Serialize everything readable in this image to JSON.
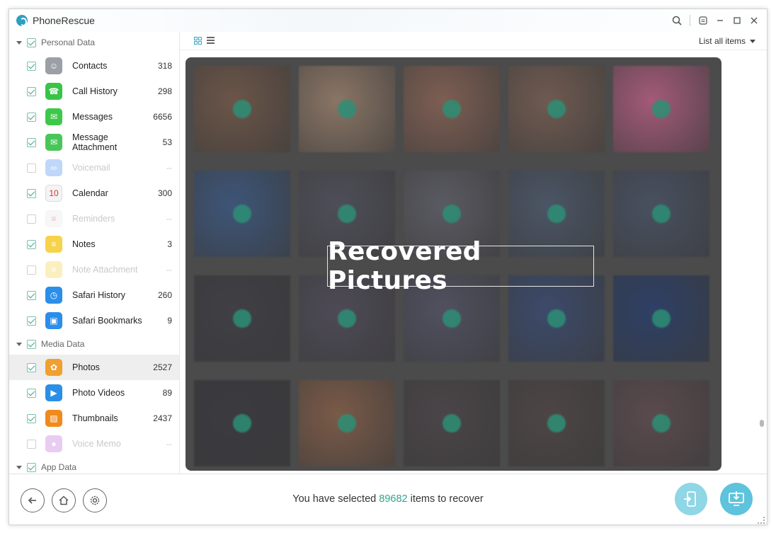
{
  "app": {
    "title": "PhoneRescue"
  },
  "titlebar": {
    "icons": [
      "search-icon",
      "menu-icon",
      "minimize-icon",
      "maximize-icon",
      "close-icon"
    ]
  },
  "sidebar": {
    "sections": [
      {
        "label": "Personal Data",
        "checked": true,
        "items": [
          {
            "label": "Contacts",
            "count": "318",
            "enabled": true,
            "checked": true,
            "icon": "contacts-icon",
            "color": "#9aa0a6"
          },
          {
            "label": "Call History",
            "count": "298",
            "enabled": true,
            "checked": true,
            "icon": "phone-icon",
            "color": "#39c447"
          },
          {
            "label": "Messages",
            "count": "6656",
            "enabled": true,
            "checked": true,
            "icon": "messages-icon",
            "color": "#3ec84a"
          },
          {
            "label": "Message Attachment",
            "count": "53",
            "enabled": true,
            "checked": true,
            "icon": "attachment-icon",
            "color": "#49c65a"
          },
          {
            "label": "Voicemail",
            "count": "--",
            "enabled": false,
            "checked": false,
            "icon": "voicemail-icon",
            "color": "#4a8ef0"
          },
          {
            "label": "Calendar",
            "count": "300",
            "enabled": true,
            "checked": true,
            "icon": "calendar-icon",
            "color": "#f4f4f4"
          },
          {
            "label": "Reminders",
            "count": "--",
            "enabled": false,
            "checked": false,
            "icon": "reminders-icon",
            "color": "#eaeaea"
          },
          {
            "label": "Notes",
            "count": "3",
            "enabled": true,
            "checked": true,
            "icon": "notes-icon",
            "color": "#f7d24b"
          },
          {
            "label": "Note Attachment",
            "count": "--",
            "enabled": false,
            "checked": false,
            "icon": "note-attachment-icon",
            "color": "#f7d24b"
          },
          {
            "label": "Safari History",
            "count": "260",
            "enabled": true,
            "checked": true,
            "icon": "safari-history-icon",
            "color": "#2b8ee8"
          },
          {
            "label": "Safari Bookmarks",
            "count": "9",
            "enabled": true,
            "checked": true,
            "icon": "safari-bookmarks-icon",
            "color": "#2b8ee8"
          }
        ]
      },
      {
        "label": "Media Data",
        "checked": true,
        "items": [
          {
            "label": "Photos",
            "count": "2527",
            "enabled": true,
            "checked": true,
            "selected": true,
            "icon": "photos-icon",
            "color": "#f0a030"
          },
          {
            "label": "Photo Videos",
            "count": "89",
            "enabled": true,
            "checked": true,
            "icon": "photo-videos-icon",
            "color": "#2c8fe6"
          },
          {
            "label": "Thumbnails",
            "count": "2437",
            "enabled": true,
            "checked": true,
            "icon": "thumbnails-icon",
            "color": "#f08a1c"
          },
          {
            "label": "Voice Memo",
            "count": "--",
            "enabled": false,
            "checked": false,
            "icon": "voice-memo-icon",
            "color": "#c070d8"
          }
        ]
      },
      {
        "label": "App Data",
        "checked": true,
        "items": []
      }
    ]
  },
  "toolbar": {
    "list_label": "List all items"
  },
  "overlay": {
    "title": "Recovered Pictures"
  },
  "photo_tiles": [
    "#6b5548",
    "#8a7565",
    "#7d5e52",
    "#6f5a50",
    "#a35a78",
    "#3e5578",
    "#4e4e58",
    "#5a5a62",
    "#4b5565",
    "#485060",
    "#3f3f45",
    "#4d4a55",
    "#505060",
    "#3c4a6a",
    "#2e4065",
    "#3a3a40",
    "#7a5a48",
    "#4a4548",
    "#4d4545",
    "#5a4a4e"
  ],
  "status": {
    "prefix": "You have selected",
    "count": "89682",
    "suffix": "items to recover"
  },
  "colors": {
    "accent": "#2ea58c",
    "action_button": "#5ec3dc"
  }
}
